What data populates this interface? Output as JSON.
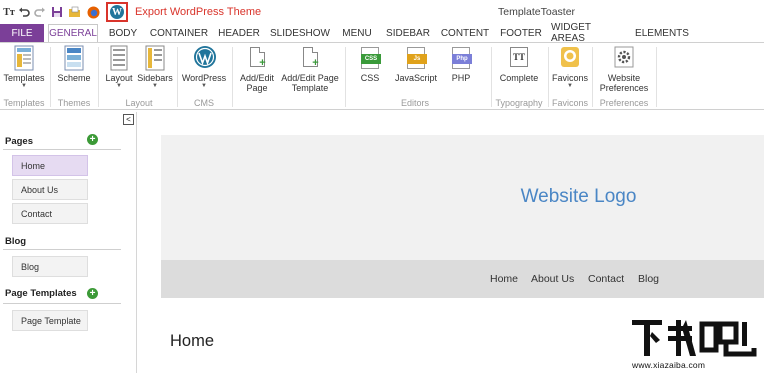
{
  "quick_access": {
    "export_label": "Export WordPress Theme",
    "app_title": "TemplateToaster"
  },
  "tabs": [
    "FILE",
    "GENERAL",
    "BODY",
    "CONTAINER",
    "HEADER",
    "SLIDESHOW",
    "MENU",
    "SIDEBAR",
    "CONTENT",
    "FOOTER",
    "WIDGET AREAS",
    "ELEMENTS"
  ],
  "ribbon": {
    "buttons": {
      "templates": "Templates",
      "scheme": "Scheme",
      "layout": "Layout",
      "sidebars": "Sidebars",
      "wordpress": "WordPress",
      "add_edit_page_1": "Add/Edit",
      "add_edit_page_2": "Page",
      "add_edit_template_1": "Add/Edit Page",
      "add_edit_template_2": "Template",
      "css": "CSS",
      "javascript": "JavaScript",
      "php": "PHP",
      "complete": "Complete",
      "favicons": "Favicons",
      "website_pref_1": "Website",
      "website_pref_2": "Preferences"
    },
    "icon_text": {
      "css": "CSS",
      "js": "Js",
      "php": "Php",
      "typography": "TT"
    },
    "groups": {
      "templates": "Templates",
      "themes": "Themes",
      "layout": "Layout",
      "cms": "CMS",
      "editors": "Editors",
      "typography": "Typography",
      "favicons": "Favicons",
      "preferences": "Preferences"
    }
  },
  "left_panel": {
    "pages_title": "Pages",
    "pages": [
      "Home",
      "About Us",
      "Contact"
    ],
    "blog_title": "Blog",
    "blog_items": [
      "Blog"
    ],
    "page_templates_title": "Page Templates",
    "page_templates": [
      "Page Template"
    ]
  },
  "canvas": {
    "logo": "Website Logo",
    "nav": [
      "Home",
      "About Us",
      "Contact",
      "Blog"
    ],
    "heading": "Home"
  },
  "watermark": {
    "url": "www.xiazaiba.com"
  },
  "colors": {
    "accent": "#7b3f98",
    "export_red": "#d9342b",
    "logo_blue": "#4a86c5",
    "add_green": "#3c9a37"
  }
}
